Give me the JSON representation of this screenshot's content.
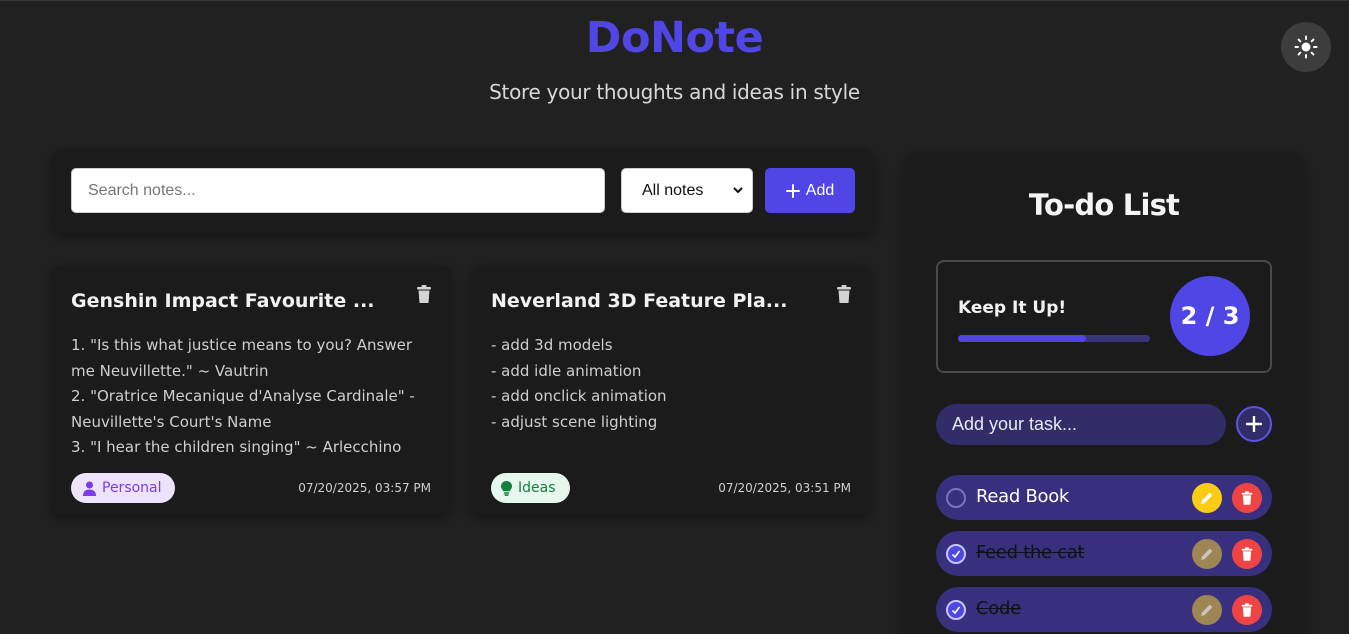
{
  "header": {
    "title": "DoNote",
    "subtitle": "Store your thoughts and ideas in style",
    "theme_icon": "sun-icon"
  },
  "toolbar": {
    "search_placeholder": "Search notes...",
    "filter_selected": "All notes",
    "add_label": "Add"
  },
  "notes": [
    {
      "title": "Genshin Impact Favourite ...",
      "lines": [
        "1. \"Is this what justice means to you? Answer",
        "me Neuvillette.\" ~ Vautrin",
        "2. \"Oratrice Mecanique d'Analyse Cardinale\" -",
        "Neuvillette's Court's Name",
        "3. \"I hear the children singing\" ~ Arlecchino"
      ],
      "tag": "Personal",
      "tag_icon": "user-icon",
      "date": "07/20/2025, 03:57 PM"
    },
    {
      "title": "Neverland 3D Feature Pla...",
      "lines": [
        "- add 3d models",
        "- add idle animation",
        "- add onclick animation",
        "- adjust scene lighting"
      ],
      "tag": "Ideas",
      "tag_icon": "lightbulb-icon",
      "date": "07/20/2025, 03:51 PM"
    }
  ],
  "todo": {
    "title": "To-do List",
    "progress_label": "Keep It Up!",
    "progress_count": "2 / 3",
    "progress_fraction": 0.667,
    "input_placeholder": "Add your task...",
    "tasks": [
      {
        "text": "Read Book",
        "done": false
      },
      {
        "text": "Feed the cat",
        "done": true
      },
      {
        "text": "Code",
        "done": true
      }
    ]
  },
  "colors": {
    "accent": "#4f46e5",
    "background": "#212121",
    "card": "#1b1b1b",
    "edit": "#facc15",
    "delete": "#ef4444"
  }
}
